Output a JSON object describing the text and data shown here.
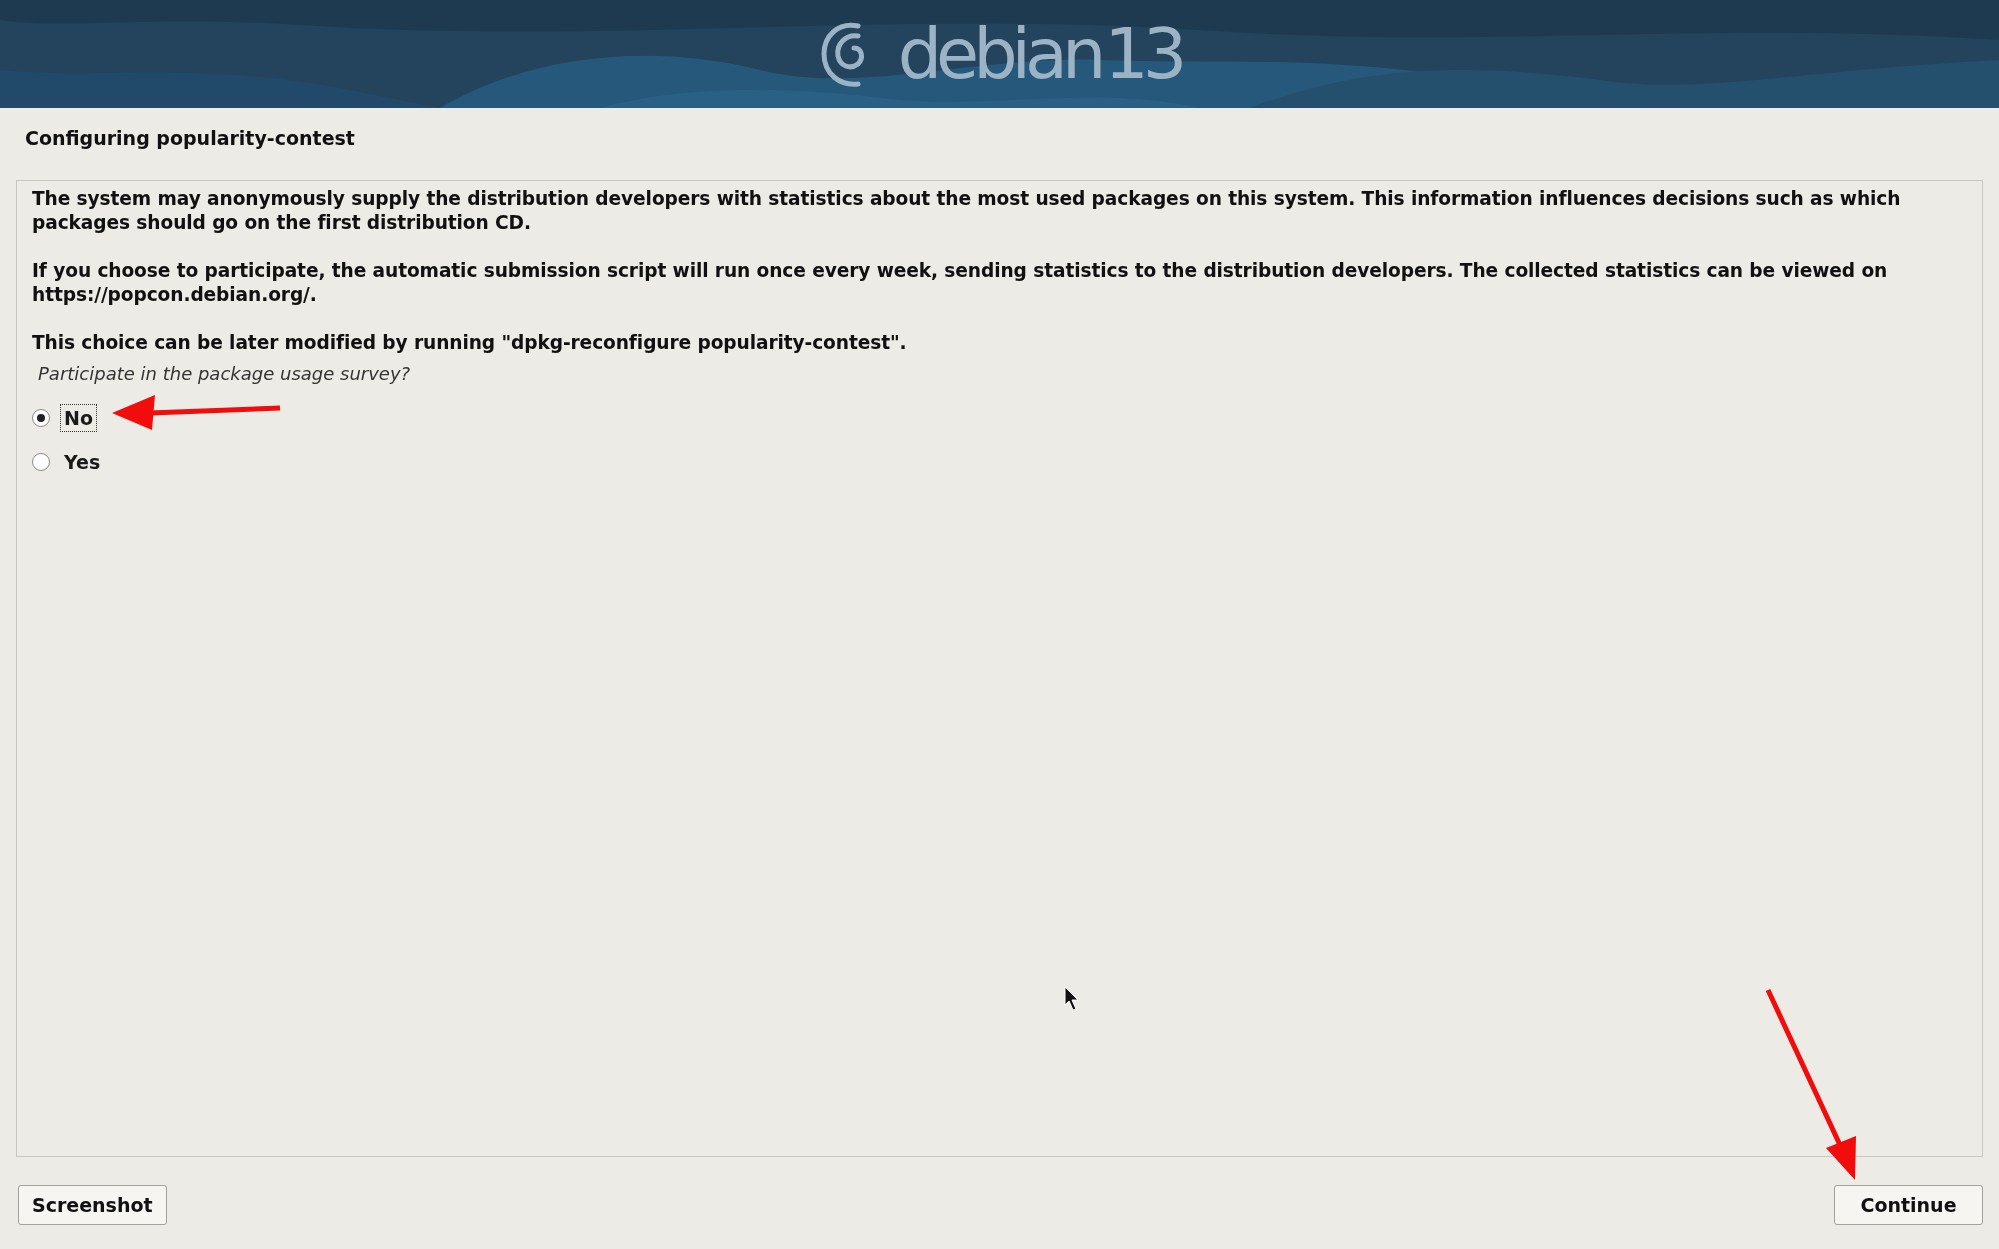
{
  "header": {
    "logo_text": "debian",
    "version": "13"
  },
  "title": "Configuring popularity-contest",
  "paragraphs": [
    "The system may anonymously supply the distribution developers with statistics about the most used packages on this system. This information influences decisions such as which packages should go on the first distribution CD.",
    "If you choose to participate, the automatic submission script will run once every week, sending statistics to the distribution developers. The collected statistics can be viewed on https://popcon.debian.org/.",
    "This choice can be later modified by running \"dpkg-reconfigure popularity-contest\"."
  ],
  "question": "Participate in the package usage survey?",
  "options": [
    {
      "label": "No",
      "selected": true,
      "focused": true
    },
    {
      "label": "Yes",
      "selected": false,
      "focused": false
    }
  ],
  "buttons": {
    "left": "Screenshot",
    "right": "Continue"
  }
}
